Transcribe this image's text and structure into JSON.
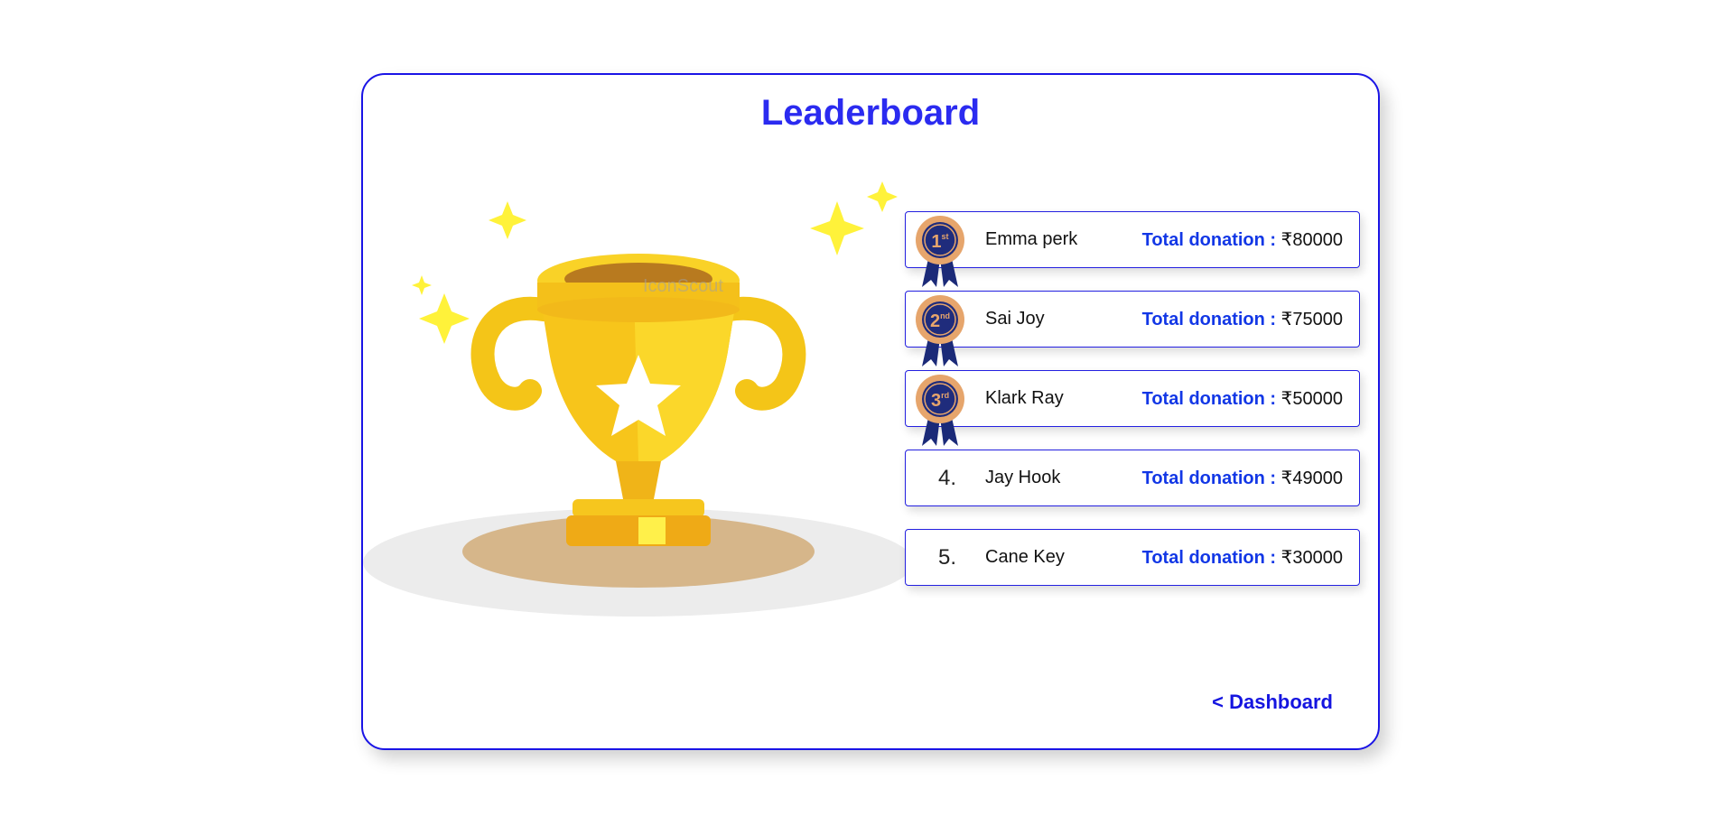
{
  "page": {
    "title": "Leaderboard",
    "accent_color": "#1a14e6",
    "title_color": "#2b2bf0",
    "label_color": "#1237e6"
  },
  "illustration": {
    "name": "trophy-icon",
    "watermark": "IconScout"
  },
  "leaderboard": {
    "donation_label": "Total donation :",
    "entries": [
      {
        "rank": "1",
        "medal": "1st",
        "name": "Emma perk",
        "amount": "₹80000"
      },
      {
        "rank": "2",
        "medal": "2nd",
        "name": "Sai Joy",
        "amount": "₹75000"
      },
      {
        "rank": "3",
        "medal": "3rd",
        "name": "Klark Ray",
        "amount": "₹50000"
      },
      {
        "rank": "4.",
        "medal": "",
        "name": "Jay Hook",
        "amount": "₹49000"
      },
      {
        "rank": "5.",
        "medal": "",
        "name": "Cane Key",
        "amount": "₹30000"
      }
    ]
  },
  "nav": {
    "back_label": "< Dashboard"
  }
}
